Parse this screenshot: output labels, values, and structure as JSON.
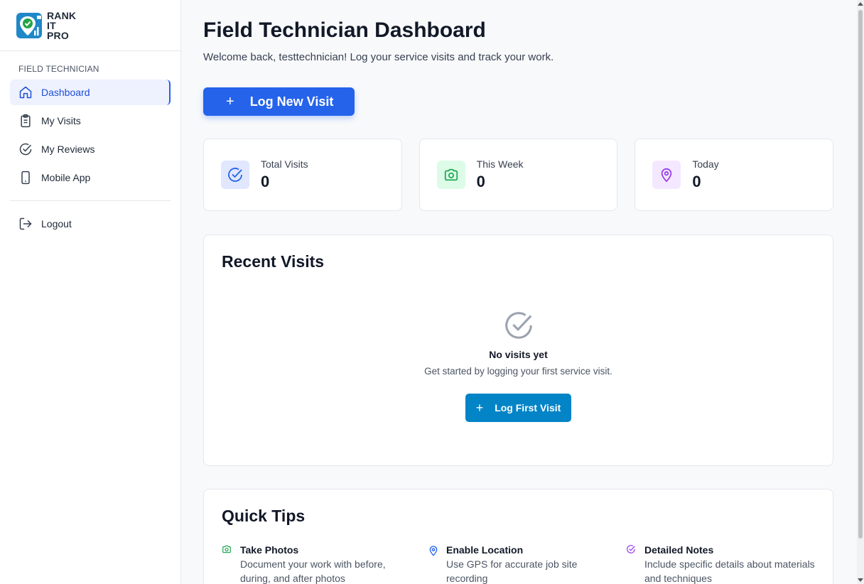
{
  "brand": {
    "line1": "RANK",
    "line2": "IT",
    "line3": "PRO",
    "icon": "map-pin-check-logo"
  },
  "sidebar": {
    "section_label": "FIELD TECHNICIAN",
    "items": [
      {
        "label": "Dashboard",
        "icon": "home-icon",
        "active": true
      },
      {
        "label": "My Visits",
        "icon": "clipboard-icon"
      },
      {
        "label": "My Reviews",
        "icon": "check-circle-icon"
      },
      {
        "label": "Mobile App",
        "icon": "smartphone-icon"
      }
    ],
    "logout_label": "Logout"
  },
  "header": {
    "title": "Field Technician Dashboard",
    "subtitle": "Welcome back, testtechnician! Log your service visits and track your work.",
    "primary_button": "Log New Visit",
    "plus": "+"
  },
  "stats": [
    {
      "label": "Total Visits",
      "value": "0",
      "icon": "check-circle-icon",
      "color": "#2563eb",
      "bg": "#e0e7ff"
    },
    {
      "label": "This Week",
      "value": "0",
      "icon": "camera-icon",
      "color": "#16a34a",
      "bg": "#dcfce7"
    },
    {
      "label": "Today",
      "value": "0",
      "icon": "map-pin-icon",
      "color": "#9333ea",
      "bg": "#f3e8ff"
    }
  ],
  "recent": {
    "title": "Recent Visits",
    "empty_title": "No visits yet",
    "empty_sub": "Get started by logging your first service visit.",
    "button": "Log First Visit"
  },
  "tips": {
    "title": "Quick Tips",
    "items": [
      {
        "title": "Take Photos",
        "desc_line1": "Document your work with before,",
        "desc_line2": "during, and after photos",
        "icon": "camera-icon",
        "color": "#16a34a"
      },
      {
        "title": "Enable Location",
        "desc_line1": "Use GPS for accurate job site",
        "desc_line2": "recording",
        "icon": "map-pin-icon",
        "color": "#2563eb"
      },
      {
        "title": "Detailed Notes",
        "desc_line1": "Include specific details about materials",
        "desc_line2": "and techniques",
        "icon": "check-circle-icon",
        "color": "#9333ea"
      }
    ]
  },
  "colors": {
    "primary": "#2563eb",
    "secondary": "#0284c7"
  }
}
